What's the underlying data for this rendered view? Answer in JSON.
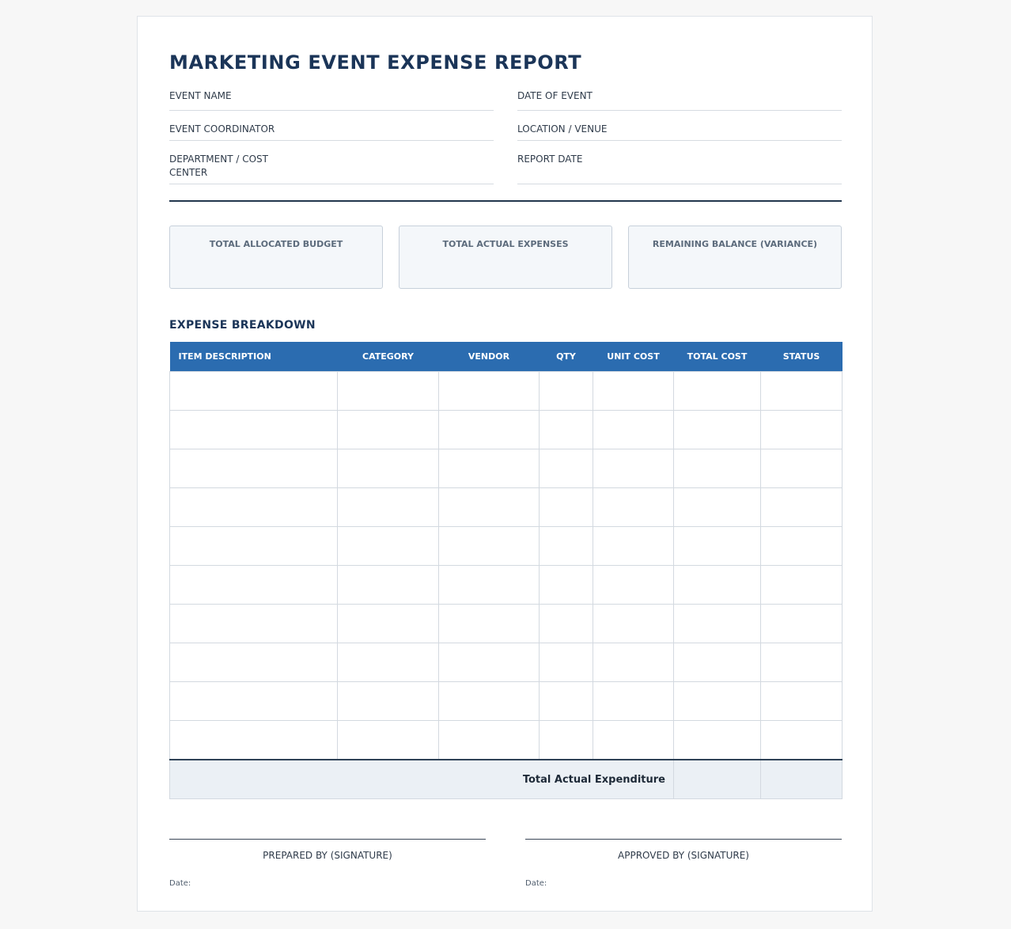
{
  "document": {
    "title": "MARKETING EVENT EXPENSE REPORT"
  },
  "fields": {
    "event_name": "EVENT NAME",
    "date_of_event": "DATE OF EVENT",
    "event_coordinator": "EVENT COORDINATOR",
    "location_venue": "LOCATION / VENUE",
    "department_cost_center": "DEPARTMENT / COST CENTER",
    "report_date": "REPORT DATE"
  },
  "summary": {
    "total_allocated_budget": "TOTAL ALLOCATED BUDGET",
    "total_actual_expenses": "TOTAL ACTUAL EXPENSES",
    "remaining_balance": "REMAINING BALANCE (VARIANCE)"
  },
  "expense_breakdown": {
    "heading": "EXPENSE BREAKDOWN",
    "columns": [
      "ITEM DESCRIPTION",
      "CATEGORY",
      "VENDOR",
      "QTY",
      "UNIT COST",
      "TOTAL COST",
      "STATUS"
    ],
    "rows": [
      [
        "",
        "",
        "",
        "",
        "",
        "",
        ""
      ],
      [
        "",
        "",
        "",
        "",
        "",
        "",
        ""
      ],
      [
        "",
        "",
        "",
        "",
        "",
        "",
        ""
      ],
      [
        "",
        "",
        "",
        "",
        "",
        "",
        ""
      ],
      [
        "",
        "",
        "",
        "",
        "",
        "",
        ""
      ],
      [
        "",
        "",
        "",
        "",
        "",
        "",
        ""
      ],
      [
        "",
        "",
        "",
        "",
        "",
        "",
        ""
      ],
      [
        "",
        "",
        "",
        "",
        "",
        "",
        ""
      ],
      [
        "",
        "",
        "",
        "",
        "",
        "",
        ""
      ],
      [
        "",
        "",
        "",
        "",
        "",
        "",
        ""
      ]
    ],
    "total_label": "Total Actual Expenditure"
  },
  "signatures": {
    "prepared_by": "PREPARED BY (SIGNATURE)",
    "approved_by": "APPROVED BY (SIGNATURE)",
    "date_label": "Date:"
  },
  "colors": {
    "title": "#1b3558",
    "table_header": "#2b6cb0",
    "card_background": "#f4f7fa",
    "total_row_background": "#ebf0f5"
  }
}
